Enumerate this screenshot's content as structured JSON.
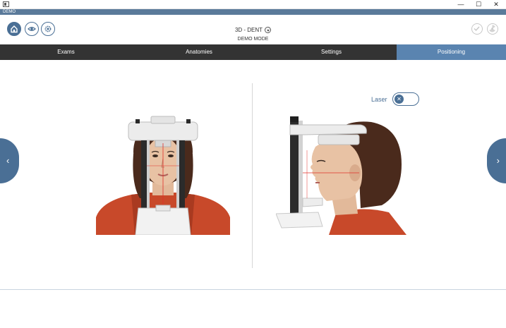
{
  "window": {
    "minimize": "—",
    "maximize": "☐",
    "close": "✕"
  },
  "app_strip": {
    "label": "DEMO"
  },
  "header": {
    "title": "3D - DENT",
    "mode": "DEMO MODE"
  },
  "tabs": [
    {
      "label": "Exams",
      "active": false
    },
    {
      "label": "Anatomies",
      "active": false
    },
    {
      "label": "Settings",
      "active": false
    },
    {
      "label": "Positioning",
      "active": true
    }
  ],
  "laser": {
    "label": "Laser",
    "state": "off"
  },
  "nav": {
    "prev": "‹",
    "next": "›"
  },
  "colors": {
    "accent": "#4a6f95",
    "tab_bar": "#333333",
    "tab_active": "#5a84b0",
    "jacket": "#c8492a"
  }
}
